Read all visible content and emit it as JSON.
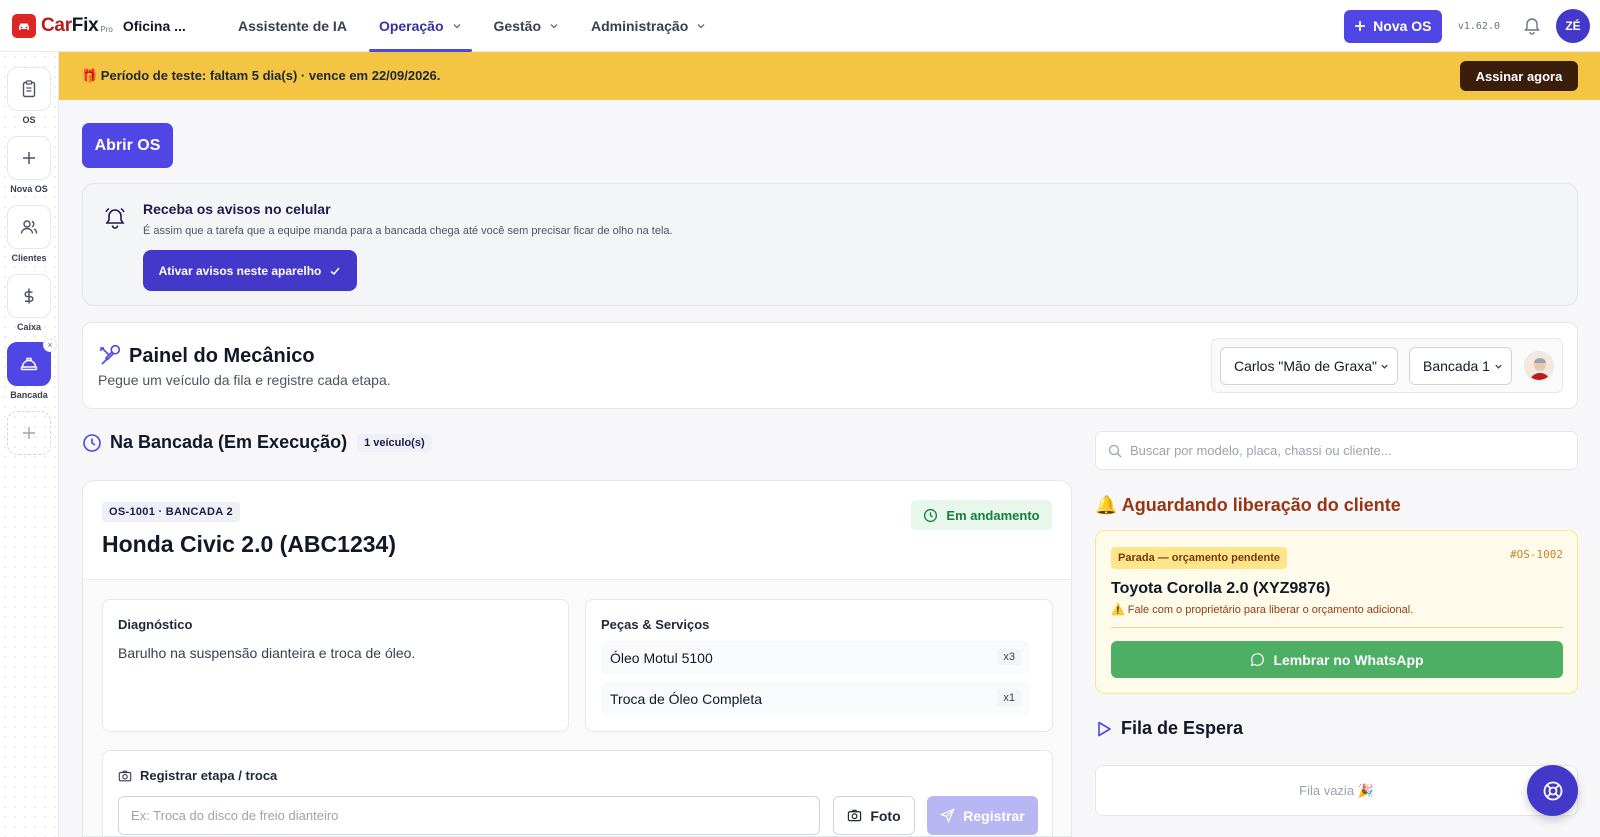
{
  "brand": {
    "car": "Car",
    "fix": "Fix",
    "pro": "Pro",
    "shop": "Oficina ..."
  },
  "nav": [
    {
      "label": "Assistente de IA",
      "dropdown": false
    },
    {
      "label": "Operação",
      "dropdown": true,
      "active": true
    },
    {
      "label": "Gestão",
      "dropdown": true
    },
    {
      "label": "Administração",
      "dropdown": true
    }
  ],
  "header": {
    "new_os_label": "Nova OS",
    "version": "v1.62.0",
    "user_initials": "ZÉ"
  },
  "sidebar": {
    "items": [
      {
        "label": "OS",
        "icon": "clipboard-icon"
      },
      {
        "label": "Nova OS",
        "icon": "plus-icon"
      },
      {
        "label": "Clientes",
        "icon": "users-icon"
      },
      {
        "label": "Caixa",
        "icon": "dollar-icon"
      },
      {
        "label": "Bancada",
        "icon": "hard-hat-icon",
        "active": true,
        "closable": "×"
      }
    ]
  },
  "banner": {
    "text": "🎁 Período de teste: faltam 5 dia(s) · vence em 22/09/2026.",
    "cta": "Assinar agora"
  },
  "main": {
    "open_os_label": "Abrir OS",
    "notifications": {
      "title": "Receba os avisos no celular",
      "subtitle": "É assim que a tarefa que a equipe manda para a bancada chega até você sem precisar ficar de olho na tela.",
      "button": "Ativar avisos neste aparelho"
    },
    "panel": {
      "title": "Painel do Mecânico",
      "subtitle": "Pegue um veículo da fila e registre cada etapa.",
      "mechanic": "Carlos \"Mão de Graxa\"",
      "bench": "Bancada 1"
    },
    "in_progress": {
      "title": "Na Bancada (Em Execução)",
      "count": "1 veículo(s)"
    },
    "job": {
      "tag": "OS-1001 · BANCADA 2",
      "vehicle": "Honda Civic 2.0 (ABC1234)",
      "status": "Em andamento",
      "diagnosis_title": "Diagnóstico",
      "diagnosis": "Barulho na suspensão dianteira e troca de óleo.",
      "parts_title": "Peças & Serviços",
      "parts": [
        {
          "name": "Óleo Motul 5100",
          "qty": "x3"
        },
        {
          "name": "Troca de Óleo Completa",
          "qty": "x1"
        }
      ],
      "register_title": "Registrar etapa / troca",
      "register_placeholder": "Ex: Troca do disco de freio dianteiro",
      "photo_label": "Foto",
      "register_label": "Registrar"
    }
  },
  "right": {
    "search_placeholder": "Buscar por modelo, placa, chassi ou cliente...",
    "awaiting_title": "🔔 Aguardando liberação do cliente",
    "awaiting": {
      "tag": "Parada — orçamento pendente",
      "id": "#OS-1002",
      "vehicle": "Toyota Corolla 2.0 (XYZ9876)",
      "warning": "⚠️ Fale com o proprietário para liberar o orçamento adicional.",
      "button": "Lembrar no WhatsApp"
    },
    "queue_title": "Fila de Espera",
    "queue_empty": "Fila vazia 🎉"
  },
  "colors": {
    "primary": "#4f46e5",
    "banner": "#f4c542",
    "success": "#15803d",
    "whatsapp": "#4caf63",
    "warning_bg": "#fffbeb"
  }
}
